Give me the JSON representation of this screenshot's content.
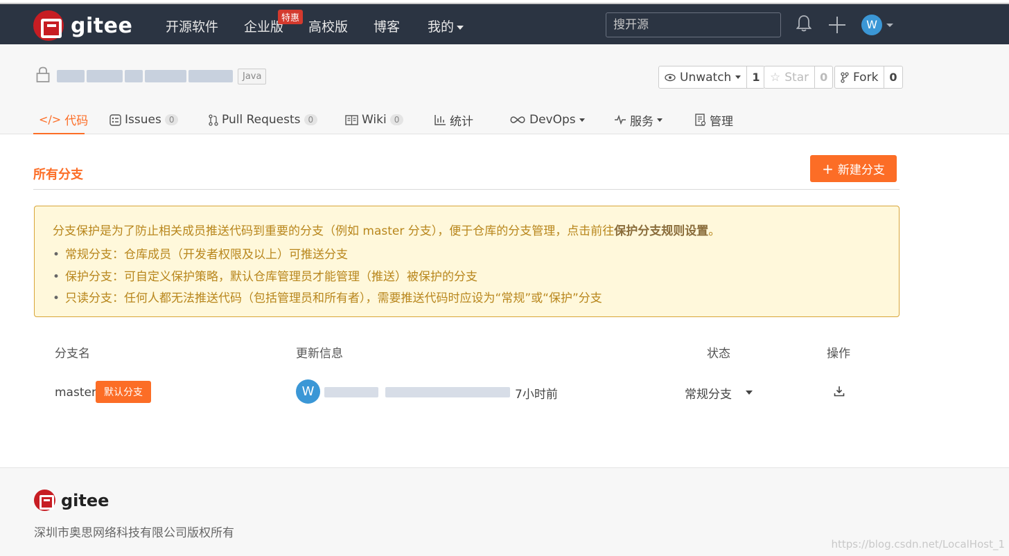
{
  "topnav": {
    "brand": "gitee",
    "items": [
      "开源软件",
      "企业版",
      "高校版",
      "博客",
      "我的"
    ],
    "hot_badge": "特惠",
    "search_placeholder": "搜开源",
    "avatar_letter": "W"
  },
  "repo": {
    "language": "Java",
    "unwatch_label": "Unwatch",
    "unwatch_count": "1",
    "star_label": "Star",
    "star_count": "0",
    "fork_label": "Fork",
    "fork_count": "0"
  },
  "tabs": [
    {
      "label": "代码",
      "icon": "code-icon"
    },
    {
      "label": "Issues",
      "count": "0",
      "icon": "issues-icon"
    },
    {
      "label": "Pull Requests",
      "count": "0",
      "icon": "pull-request-icon"
    },
    {
      "label": "Wiki",
      "count": "0",
      "icon": "wiki-icon"
    },
    {
      "label": "统计",
      "icon": "stats-icon"
    },
    {
      "label": "DevOps",
      "icon": "devops-icon"
    },
    {
      "label": "服务",
      "icon": "service-icon"
    },
    {
      "label": "管理",
      "icon": "manage-icon"
    }
  ],
  "branches": {
    "title": "所有分支",
    "new_button": "新建分支",
    "notice": {
      "intro": "分支保护是为了防止相关成员推送代码到重要的分支（例如 master 分支），便于仓库的分支管理，点击前往",
      "link": "保护分支规则设置",
      "intro_end": "。",
      "items": [
        "常规分支：仓库成员（开发者权限及以上）可推送分支",
        "保护分支：可自定义保护策略，默认仓库管理员才能管理（推送）被保护的分支",
        "只读分支：任何人都无法推送代码（包括管理员和所有者），需要推送代码时应设为“常规”或“保护”分支"
      ]
    },
    "columns": [
      "分支名",
      "更新信息",
      "状态",
      "操作"
    ],
    "rows": [
      {
        "name": "master",
        "badge": "默认分支",
        "avatar": "W",
        "updated": "7小时前",
        "status": "常规分支"
      }
    ]
  },
  "footer": {
    "brand": "gitee",
    "copyright": "深圳市奥思网络科技有限公司版权所有",
    "watermark": "https://blog.csdn.net/LocalHost_1"
  },
  "colors": {
    "accent": "#fc6d26",
    "nav_bg": "#2b3442",
    "brand_red": "#c71d23",
    "notice_bg": "#fff8db"
  }
}
